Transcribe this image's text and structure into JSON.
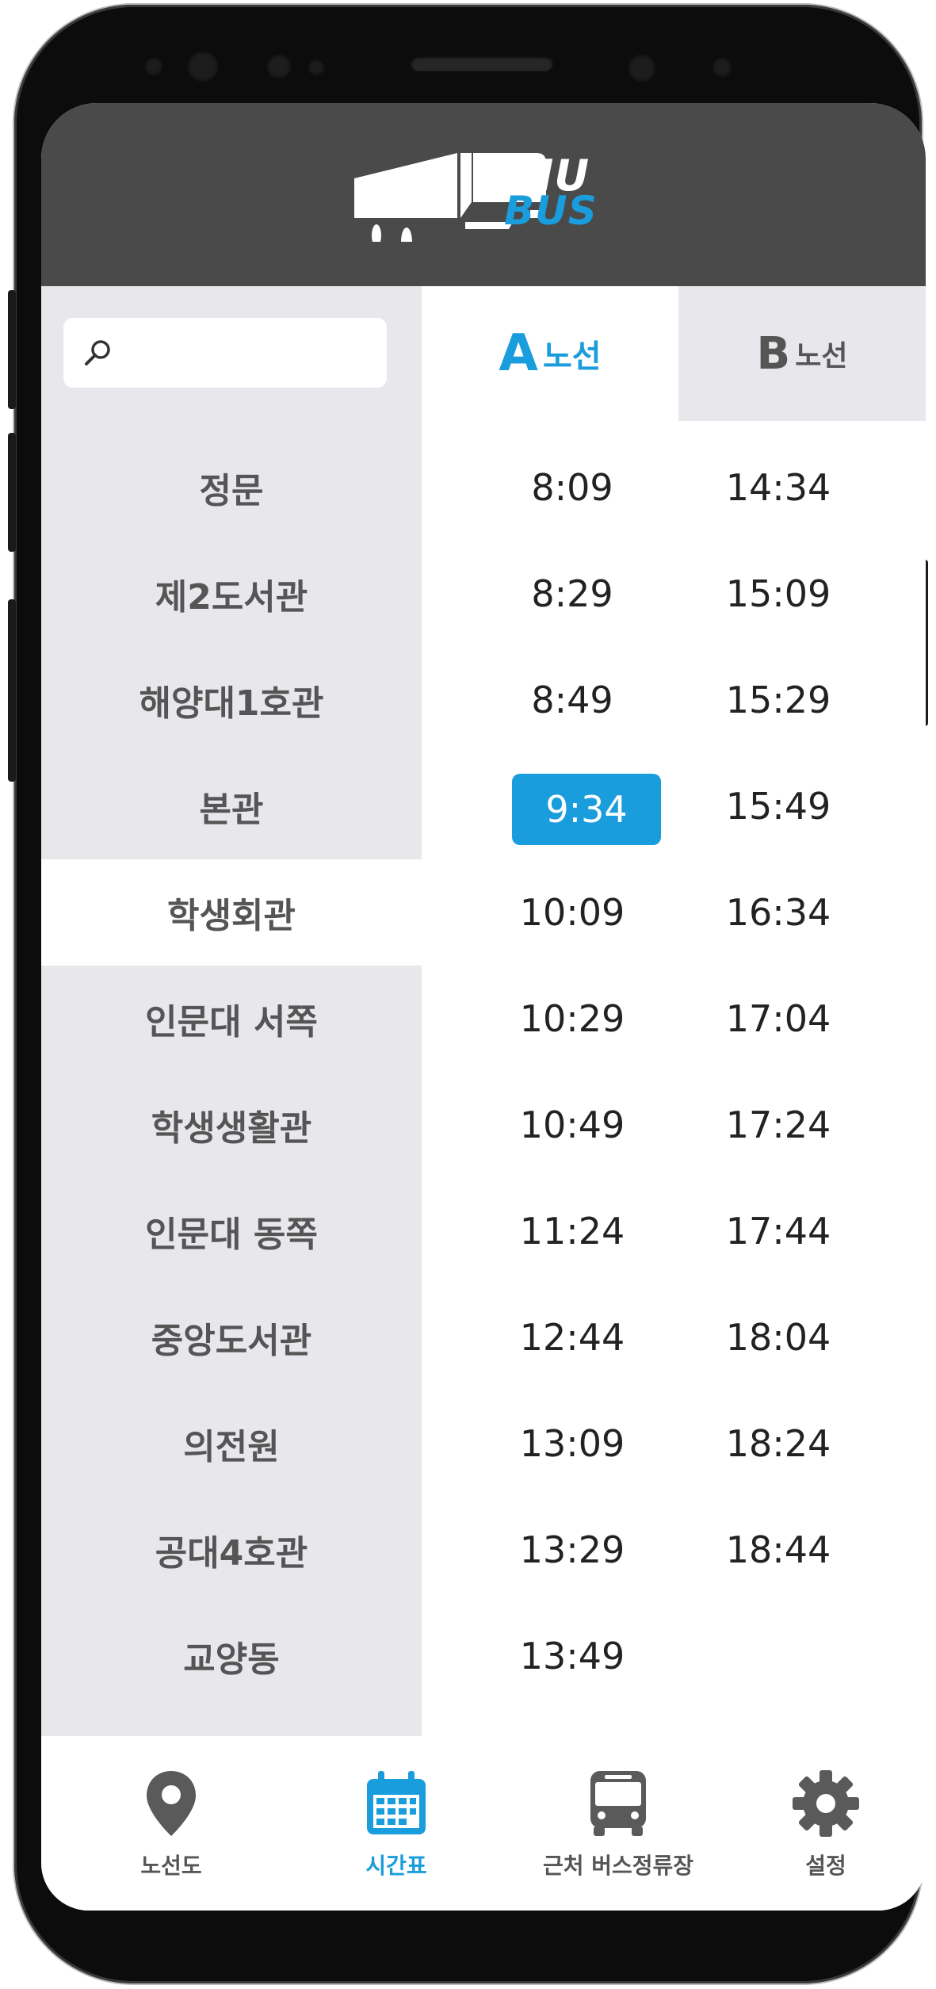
{
  "app": {
    "logo_top": "JNU",
    "logo_bottom": "BUS",
    "accent_color": "#1a9ddc",
    "header_color": "#4a4a4a"
  },
  "search": {
    "placeholder": "",
    "icon": "search-icon"
  },
  "tabs": [
    {
      "letter": "A",
      "word": "노선",
      "selected": true
    },
    {
      "letter": "B",
      "word": "노선",
      "selected": false
    }
  ],
  "stops": [
    {
      "name": "정문",
      "time_a": "8:09",
      "time_b": "14:34"
    },
    {
      "name": "제2도서관",
      "time_a": "8:29",
      "time_b": "15:09"
    },
    {
      "name": "해양대1호관",
      "time_a": "8:49",
      "time_b": "15:29"
    },
    {
      "name": "본관",
      "time_a": "9:34",
      "time_b": "15:49"
    },
    {
      "name": "학생회관",
      "time_a": "10:09",
      "time_b": "16:34"
    },
    {
      "name": "인문대 서쪽",
      "time_a": "10:29",
      "time_b": "17:04"
    },
    {
      "name": "학생생활관",
      "time_a": "10:49",
      "time_b": "17:24"
    },
    {
      "name": "인문대 동쪽",
      "time_a": "11:24",
      "time_b": "17:44"
    },
    {
      "name": "중앙도서관",
      "time_a": "12:44",
      "time_b": "18:04"
    },
    {
      "name": "의전원",
      "time_a": "13:09",
      "time_b": "18:24"
    },
    {
      "name": "공대4호관",
      "time_a": "13:29",
      "time_b": "18:44"
    },
    {
      "name": "교양동",
      "time_a": "13:49",
      "time_b": ""
    }
  ],
  "selected_stop": "학생회관",
  "highlighted_time": "9:34",
  "nav": [
    {
      "label": "노선도",
      "icon": "map-pin-icon",
      "active": false
    },
    {
      "label": "시간표",
      "icon": "calendar-icon",
      "active": true
    },
    {
      "label": "근처 버스정류장",
      "icon": "bus-icon",
      "active": false
    },
    {
      "label": "설정",
      "icon": "gear-icon",
      "active": false
    }
  ]
}
